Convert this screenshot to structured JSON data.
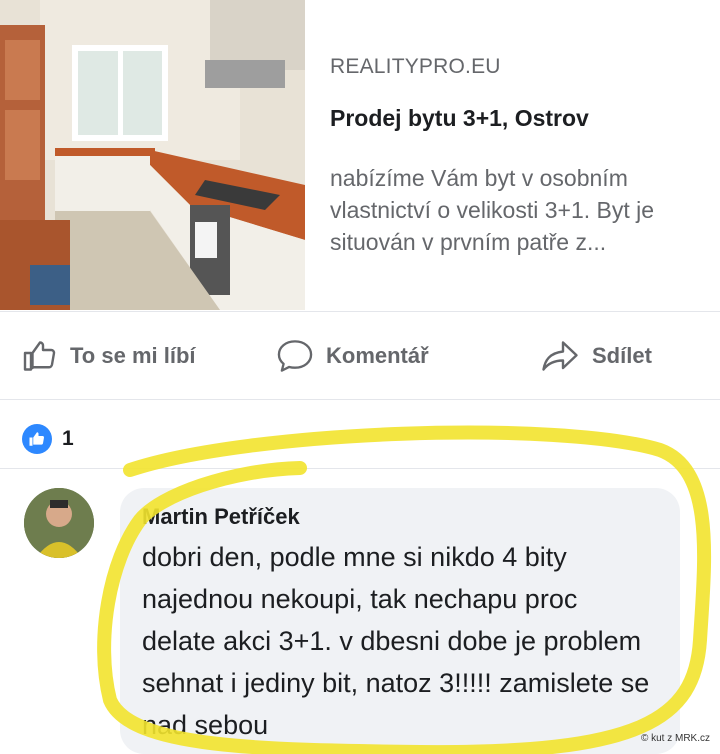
{
  "preview": {
    "domain": "REALITYPRO.EU",
    "headline": "Prodej bytu 3+1, Ostrov",
    "description": "nabízíme Vám byt v osobním vlastnictví o velikosti 3+1. Byt je situován v prvním patře z...",
    "image_icon": "kitchen-photo"
  },
  "actions": {
    "like_label": "To se mi líbí",
    "comment_label": "Komentář",
    "share_label": "Sdílet"
  },
  "reactions": {
    "count": "1"
  },
  "comment": {
    "author": "Martin Petříček",
    "text": "dobri den, podle mne si nikdo 4 bity najednou nekoupi, tak nechapu proc delate akci 3+1. v dbesni dobe je problem sehnat i jediny bit, natoz 3!!!!! zamislete se nad sebou"
  },
  "watermark": "© kut z MRK.cz",
  "colors": {
    "accent": "#2d88ff",
    "highlight": "#f2e32e",
    "bubble": "#f0f2f5"
  }
}
